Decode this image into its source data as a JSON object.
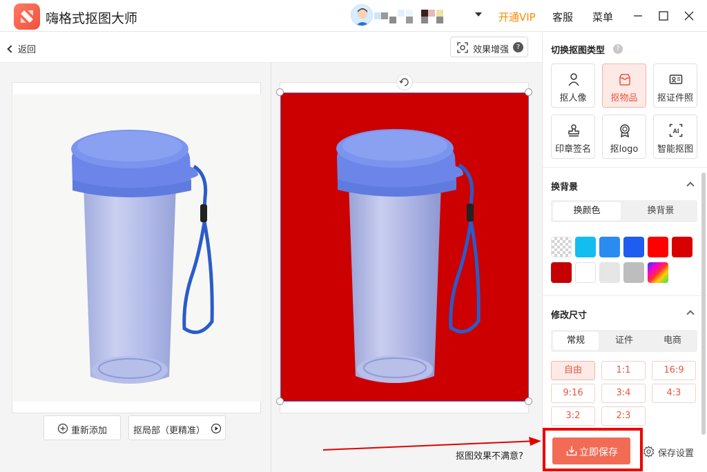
{
  "app": {
    "title": "嗨格式抠图大师",
    "vip_label": "开通VIP",
    "service_label": "客服",
    "menu_label": "菜单"
  },
  "toolbar": {
    "back_label": "返回",
    "enhance_label": "效果增强"
  },
  "canvas": {
    "readd_label": "重新添加",
    "local_cutout_label": "抠局部（更精准）",
    "unsatisfied_label": "抠图效果不满意?",
    "result_background_color": "#cc0000"
  },
  "right_panel": {
    "cutout_type_title": "切换抠图类型",
    "types": [
      {
        "label": "抠人像",
        "icon": "person-icon"
      },
      {
        "label": "抠物品",
        "icon": "bag-icon",
        "active": true
      },
      {
        "label": "抠证件照",
        "icon": "id-card-icon"
      },
      {
        "label": "印章签名",
        "icon": "stamp-icon"
      },
      {
        "label": "抠logo",
        "icon": "badge-icon"
      },
      {
        "label": "智能抠图",
        "icon": "ai-icon"
      }
    ],
    "background_title": "换背景",
    "background_tabs": [
      "换颜色",
      "换背景"
    ],
    "swatch_colors": [
      "transparent",
      "#12bef0",
      "#2a8cf0",
      "#1f5cf0",
      "#ff0000",
      "#d80000",
      "#c40000",
      "#ffffff",
      "#e6e6e6",
      "#bdbdbd",
      "gradient"
    ],
    "resize_title": "修改尺寸",
    "resize_tabs": [
      "常规",
      "证件",
      "电商"
    ],
    "ratios": [
      "自由",
      "1:1",
      "16:9",
      "9:16",
      "3:4",
      "4:3",
      "3:2",
      "2:3"
    ],
    "save_label": "立即保存",
    "save_settings_label": "保存设置"
  }
}
